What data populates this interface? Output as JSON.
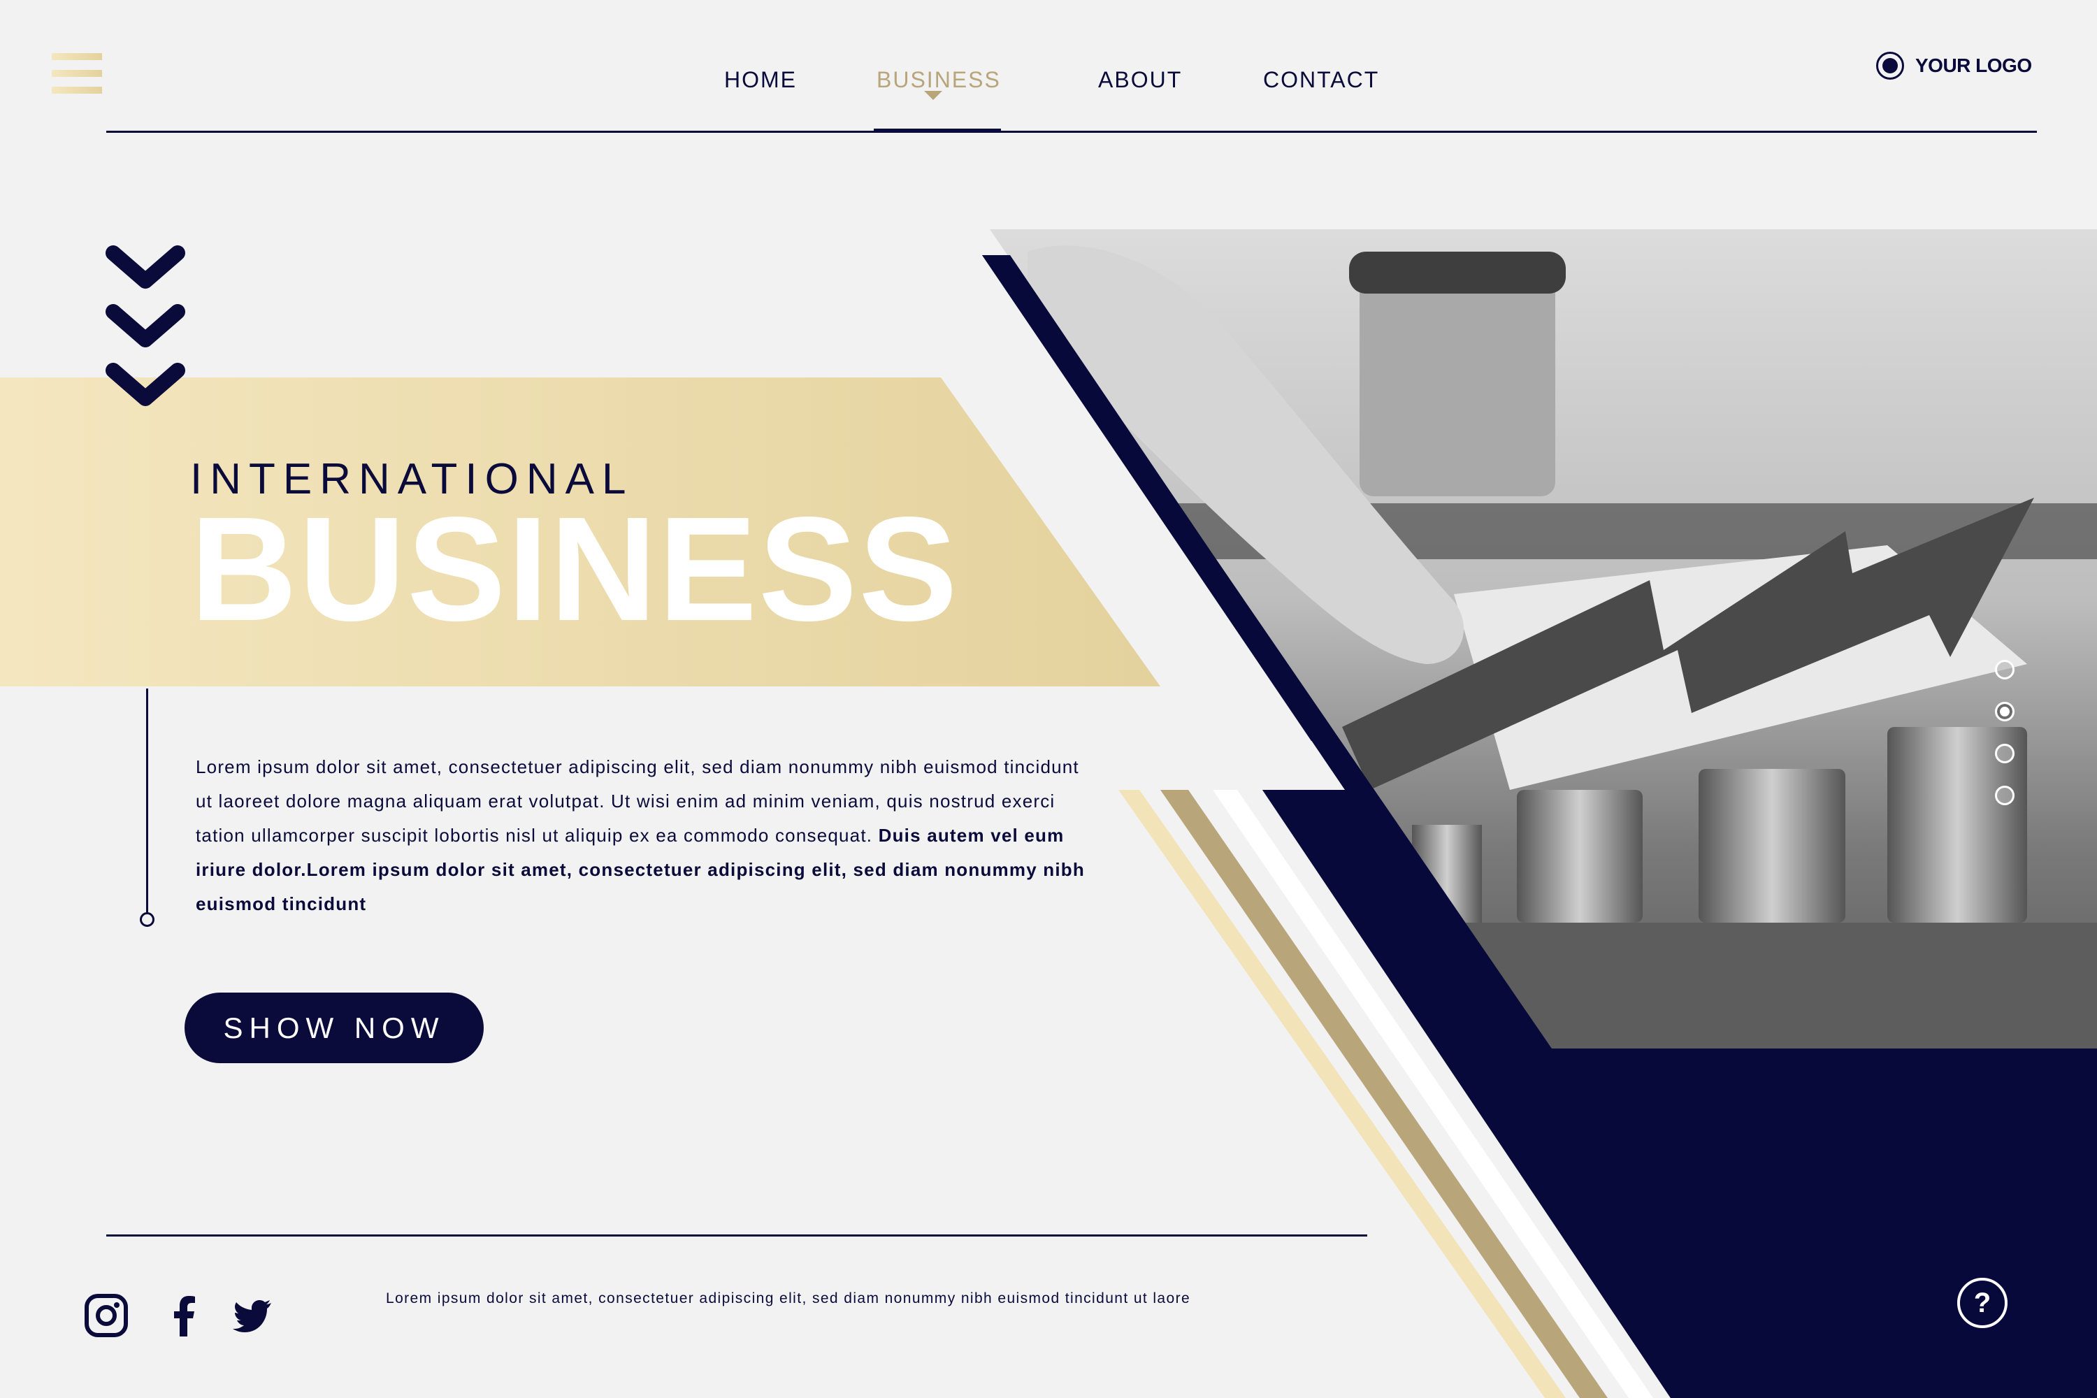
{
  "nav": {
    "items": [
      {
        "label": "HOME"
      },
      {
        "label": "BUSINESS"
      },
      {
        "label": "ABOUT"
      },
      {
        "label": "CONTACT"
      }
    ],
    "active_index": 1
  },
  "logo": {
    "text": "YOUR LOGO"
  },
  "hero": {
    "subtitle": "INTERNATIONAL",
    "title": "BUSINESS",
    "paragraph": "Lorem ipsum dolor sit amet, consectetuer adipiscing elit, sed diam nonummy nibh euismod tincidunt ut laoreet dolore magna aliquam erat volutpat. Ut wisi enim ad minim veniam, quis nostrud exerci tation ullamcorper suscipit lobortis nisl ut aliquip ex ea commodo consequat.",
    "paragraph_bold": "Duis autem vel eum iriure dolor.Lorem ipsum dolor sit amet, consectetuer adipiscing elit, sed diam nonummy nibh euismod tincidunt",
    "cta_label": "SHOW NOW"
  },
  "slider": {
    "count": 4,
    "active_index": 1
  },
  "footer": {
    "text": "Lorem ipsum dolor sit amet, consectetuer adipiscing elit, sed diam nonummy nibh euismod tincidunt ut laore",
    "social": [
      "instagram-icon",
      "facebook-icon",
      "twitter-icon"
    ],
    "help_label": "?"
  },
  "colors": {
    "navy": "#0a0b3a",
    "gold": "#b8a57a",
    "gold_light": "#f2e3b8",
    "background": "#f2f2f2"
  }
}
